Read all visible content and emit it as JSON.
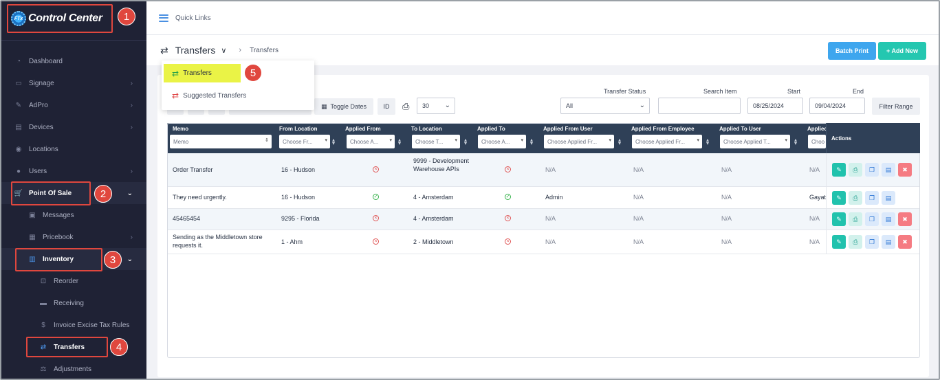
{
  "sidebar": {
    "logo_mark": "FTx",
    "logo_text": "Control Center",
    "items": [
      {
        "label": "Dashboard",
        "icon": "dashboard-icon"
      },
      {
        "label": "Signage",
        "icon": "monitor-icon"
      },
      {
        "label": "AdPro",
        "icon": "pen-icon"
      },
      {
        "label": "Devices",
        "icon": "devices-icon"
      },
      {
        "label": "Locations",
        "icon": "location-icon"
      },
      {
        "label": "Users",
        "icon": "users-icon"
      },
      {
        "label": "Point Of Sale",
        "icon": "cart-icon"
      },
      {
        "label": "Messages",
        "icon": "message-icon"
      },
      {
        "label": "Pricebook",
        "icon": "book-icon"
      },
      {
        "label": "Inventory",
        "icon": "inventory-icon"
      },
      {
        "label": "Reorder",
        "icon": "reorder-cart-icon"
      },
      {
        "label": "Receiving",
        "icon": "truck-icon"
      },
      {
        "label": "Invoice Excise Tax Rules",
        "icon": "dollar-icon"
      },
      {
        "label": "Transfers",
        "icon": "transfer-icon"
      },
      {
        "label": "Adjustments",
        "icon": "scale-icon"
      }
    ]
  },
  "badges": [
    "1",
    "2",
    "3",
    "4",
    "5"
  ],
  "topbar": {
    "quick_links": "Quick Links"
  },
  "header": {
    "title": "Transfers",
    "breadcrumb": "Transfers",
    "batch_print": "Batch Print",
    "add_new": "+ Add New"
  },
  "dropdown": {
    "item1": "Transfers",
    "item2": "Suggested Transfers"
  },
  "filters": {
    "toggle_dates": "Toggle Dates",
    "id_label": "ID",
    "page_size": "30",
    "status_label": "Transfer Status",
    "status_value": "All",
    "search_label": "Search Item",
    "start_label": "Start",
    "start_value": "08/25/2024",
    "end_label": "End",
    "end_value": "09/04/2024",
    "filter_range": "Filter Range"
  },
  "table": {
    "columns": [
      {
        "label": "Memo",
        "filter": "Memo"
      },
      {
        "label": "From Location",
        "filter": "Choose Fr..."
      },
      {
        "label": "Applied From",
        "filter": "Choose A..."
      },
      {
        "label": "To Location",
        "filter": "Choose T..."
      },
      {
        "label": "Applied To",
        "filter": "Choose A..."
      },
      {
        "label": "Applied From User",
        "filter": "Choose Applied Fr..."
      },
      {
        "label": "Applied From Employee",
        "filter": "Choose Applied Fr..."
      },
      {
        "label": "Applied To User",
        "filter": "Choose Applied T..."
      },
      {
        "label": "Applied",
        "filter": "Choo"
      }
    ],
    "actions_label": "Actions",
    "rows": [
      {
        "memo": "Order Transfer",
        "from": "16 - Hudson",
        "to": "9999 - Development Warehouse APIs",
        "from_user": "N/A",
        "from_emp": "N/A",
        "to_user": "N/A",
        "last": "N/A"
      },
      {
        "memo": "They need urgently.",
        "from": "16 - Hudson",
        "to": "4 - Amsterdam",
        "from_user": "Admin",
        "from_emp": "N/A",
        "to_user": "N/A",
        "last": "Gayat"
      },
      {
        "memo": "45465454",
        "from": "9295 - Florida",
        "to": "4 - Amsterdam",
        "from_user": "N/A",
        "from_emp": "N/A",
        "to_user": "N/A",
        "last": "N/A"
      },
      {
        "memo": "Sending as the Middletown store requests it.",
        "from": "1 - Ahm",
        "to": "2 - Middletown",
        "from_user": "N/A",
        "from_emp": "N/A",
        "to_user": "N/A",
        "last": "N/A"
      }
    ]
  },
  "colors": {
    "sidebar_bg": "#1f2235",
    "table_header": "#2f4057",
    "annotation_red": "#e0473e",
    "highlight_yellow": "#eaf346",
    "batch_blue": "#3ea6ee",
    "add_teal": "#24c7b0"
  }
}
